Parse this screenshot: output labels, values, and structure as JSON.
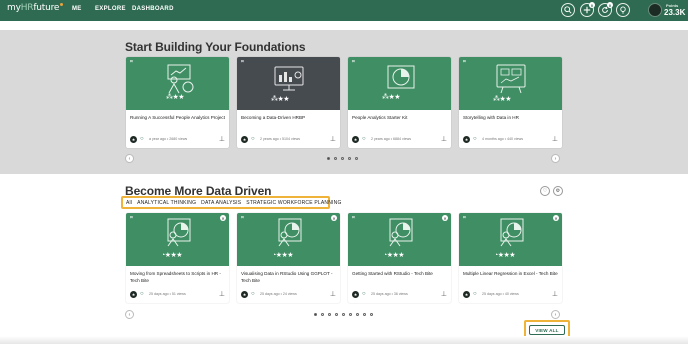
{
  "header": {
    "logo": {
      "prefix": "my",
      "accent": "HR",
      "suffix": "future"
    },
    "nav": [
      "ME",
      "EXPLORE",
      "DASHBOARD"
    ],
    "icons": [
      {
        "name": "search-icon",
        "glyph": "⌕",
        "badge": ""
      },
      {
        "name": "add-icon",
        "glyph": "+",
        "badge": "0"
      },
      {
        "name": "refresh-icon",
        "glyph": "⟳",
        "badge": "0"
      },
      {
        "name": "lightbulb-icon",
        "glyph": "💡",
        "badge": ""
      }
    ],
    "points_label": "Points",
    "points_value": "23.3K"
  },
  "foundations": {
    "title": "Start Building Your Foundations",
    "cards": [
      {
        "title": "Running A Successful People Analytics Project",
        "meta": "a year ago • 2680 views",
        "image": "presenter-icon"
      },
      {
        "title": "Becoming a Data-Driven HRBP",
        "meta": "2 years ago • 5104 views",
        "image": "monitor-chart-icon"
      },
      {
        "title": "People Analytics Starter Kit",
        "meta": "2 years ago • 6884 views",
        "image": "pie-chart-icon"
      },
      {
        "title": "Storytelling with Data in HR",
        "meta": "4 months ago • 440 views",
        "image": "dashboard-board-icon"
      }
    ],
    "dots": 5,
    "active_dot": 0
  },
  "data_driven": {
    "title": "Become More Data Driven",
    "tabs": [
      "All",
      "ANALYTICAL THINKING",
      "DATA ANALYSIS",
      "STRATEGIC WORKFORCE PLANNING"
    ],
    "cards": [
      {
        "title": "Moving from Spreadsheets to Scripts in HR - Tech Bite",
        "meta": "25 days ago • 51 views"
      },
      {
        "title": "Visualising Data in RStudio Using GGPLOT - Tech Bite",
        "meta": "25 days ago • 24 views"
      },
      {
        "title": "Getting Started with RStudio - Tech Bite",
        "meta": "25 days ago • 36 views"
      },
      {
        "title": "Multiple Linear Regression in Excel - Tech Bite",
        "meta": "25 days ago • 40 views"
      }
    ],
    "dots": 9,
    "active_dot": 0,
    "view_all": "VIEW ALL"
  },
  "colors": {
    "brand_green": "#2f6b52",
    "card_green": "#3f8e64",
    "highlight": "#f0b33a"
  }
}
